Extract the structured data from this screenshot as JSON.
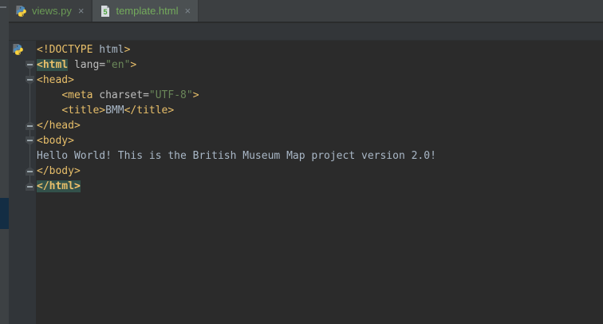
{
  "app": {
    "name": "PyCharm editor",
    "theme": "darcula"
  },
  "colors": {
    "editor_bg": "#2b2b2b",
    "gutter_bg": "#313539",
    "tabbar_bg": "#3c3f41",
    "tab_active_bg": "#4b5052",
    "band_bg": "#333639",
    "strip_bg": "#3d4144",
    "strip_selection": "#132d44",
    "tab_text": "#6a9a55",
    "tab_text_active": "#74ab5c",
    "tag": "#e8bf6a",
    "tag_bright": "#ffc66d",
    "attr": "#bdbdbd",
    "value": "#6a8759",
    "plain": "#a9b7c6",
    "match_bg": "#33514a"
  },
  "tabs": [
    {
      "label": "views.py",
      "icon": "python-file-icon",
      "close_glyph": "×",
      "active": false
    },
    {
      "label": "template.html",
      "icon": "html-file-icon",
      "close_glyph": "×",
      "active": true
    }
  ],
  "editor": {
    "lines": [
      {
        "gutter_icon": "python-file-icon",
        "tokens": [
          {
            "text": "<!DOCTYPE ",
            "c": "tag"
          },
          {
            "text": "html",
            "c": "plain"
          },
          {
            "text": ">",
            "c": "tag"
          }
        ]
      },
      {
        "fold": "start",
        "tokens": [
          {
            "text": "<html",
            "c": "tag",
            "hl": true,
            "b": true
          },
          {
            "text": " ",
            "c": "plain"
          },
          {
            "text": "lang",
            "c": "attr"
          },
          {
            "text": "=",
            "c": "attr"
          },
          {
            "text": "\"en\"",
            "c": "value"
          },
          {
            "text": ">",
            "c": "tag"
          }
        ]
      },
      {
        "fold": "start",
        "tokens": [
          {
            "text": "<head>",
            "c": "tag"
          }
        ]
      },
      {
        "tokens": [
          {
            "text": "    ",
            "c": "plain"
          },
          {
            "text": "<meta ",
            "c": "tag"
          },
          {
            "text": "charset",
            "c": "attr"
          },
          {
            "text": "=",
            "c": "attr"
          },
          {
            "text": "\"UTF-8\"",
            "c": "value"
          },
          {
            "text": ">",
            "c": "tag"
          }
        ]
      },
      {
        "tokens": [
          {
            "text": "    ",
            "c": "plain"
          },
          {
            "text": "<title>",
            "c": "tag"
          },
          {
            "text": "BMM",
            "c": "plain"
          },
          {
            "text": "</title>",
            "c": "tag"
          }
        ]
      },
      {
        "fold": "end",
        "tokens": [
          {
            "text": "</head>",
            "c": "tag"
          }
        ]
      },
      {
        "fold": "start",
        "tokens": [
          {
            "text": "<body>",
            "c": "tag"
          }
        ]
      },
      {
        "tokens": [
          {
            "text": "Hello World! This is the British Museum Map project version 2.0!",
            "c": "plain"
          }
        ]
      },
      {
        "fold": "end",
        "tokens": [
          {
            "text": "</body>",
            "c": "tag"
          }
        ]
      },
      {
        "fold": "end",
        "tokens": [
          {
            "text": "</html",
            "c": "tag",
            "hl": true,
            "b": true
          },
          {
            "text": ">",
            "c": "bright",
            "hl": true,
            "b": true
          }
        ]
      }
    ]
  }
}
